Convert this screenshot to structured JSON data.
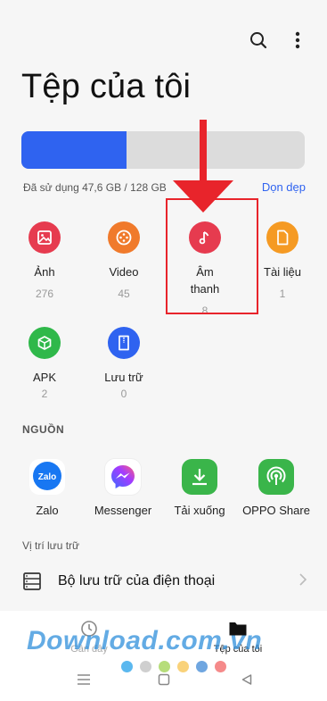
{
  "header": {
    "title": "Tệp của tôi",
    "icons": [
      "search-icon",
      "more-vertical-icon"
    ]
  },
  "storage": {
    "used_text": "Đã sử dụng 47,6 GB / 128 GB",
    "used_fraction": 0.372,
    "cleanup_label": "Dọn dẹp",
    "bar_color": "#2f63f0"
  },
  "categories": [
    {
      "label": "Ảnh",
      "count": "276",
      "color": "#e63b4f",
      "icon": "image-icon"
    },
    {
      "label": "Video",
      "count": "45",
      "color": "#f07a2b",
      "icon": "video-icon"
    },
    {
      "label": "Âm thanh",
      "count": "8",
      "color": "#e63b4f",
      "icon": "music-icon"
    },
    {
      "label": "Tài liệu",
      "count": "1",
      "color": "#f59a23",
      "icon": "document-icon"
    },
    {
      "label": "APK",
      "count": "2",
      "color": "#2fb84a",
      "icon": "apk-icon"
    },
    {
      "label": "Lưu trữ",
      "count": "0",
      "color": "#2f63f0",
      "icon": "archive-icon"
    }
  ],
  "sources": {
    "title": "NGUỒN",
    "items": [
      {
        "label": "Zalo",
        "color": "#1877f2",
        "icon": "zalo-icon",
        "icon_text": "Zalo"
      },
      {
        "label": "Messenger",
        "color": "#ffffff",
        "icon": "messenger-icon"
      },
      {
        "label": "Tải xuống",
        "color": "#3ab54a",
        "icon": "download-icon"
      },
      {
        "label": "OPPO Share",
        "color": "#3ab54a",
        "icon": "oppo-share-icon"
      }
    ]
  },
  "storage_location": {
    "title": "Vị trí lưu trữ",
    "phone_storage": "Bộ lưu trữ của điện thoại"
  },
  "tabs": [
    {
      "label": "Gần đây",
      "icon": "clock-icon",
      "active": false
    },
    {
      "label": "Tệp của tôi",
      "icon": "folder-icon",
      "active": true
    }
  ],
  "watermark": "Download.com.vn",
  "watermark_dots": [
    "#5bb8ef",
    "#cfcfcf",
    "#b6dd7a",
    "#f9d27a",
    "#6fa6e0",
    "#f58a8a"
  ],
  "annotation": {
    "highlight_color": "#e8242b"
  }
}
